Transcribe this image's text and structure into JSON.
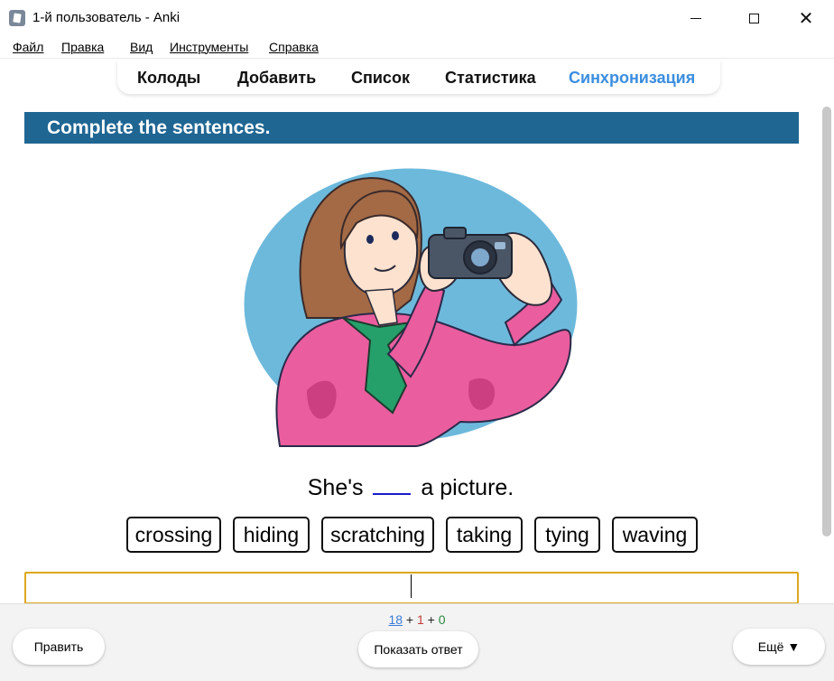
{
  "window": {
    "title": "1-й пользователь - Anki",
    "minimize_glyph": "",
    "close_glyph": "✕"
  },
  "menu": [
    {
      "label": "Файл"
    },
    {
      "label": "Правка"
    },
    {
      "label": "Вид"
    },
    {
      "label": "Инструменты"
    },
    {
      "label": "Справка"
    }
  ],
  "toolbar": {
    "decks": "Колоды",
    "add": "Добавить",
    "browse": "Список",
    "stats": "Статистика",
    "sync": "Синхронизация"
  },
  "card": {
    "header": "Complete the sentences.",
    "sentence_before": "She's",
    "sentence_after": "a picture.",
    "words": [
      "crossing",
      "hiding",
      "scratching",
      "taking",
      "tying",
      "waving"
    ],
    "answer_value": ""
  },
  "bottom": {
    "count_new": "18",
    "count_learn": "1",
    "count_review": "0",
    "plus": "+",
    "edit": "Править",
    "show_answer": "Показать ответ",
    "more": "Ещё ▼"
  },
  "colors": {
    "header_bg": "#1f6693",
    "sync_active": "#3b8ee0",
    "answer_border": "#dca81d",
    "blank_underline": "#1a1acc"
  },
  "icons": {
    "app": "anki-icon",
    "minimize": "minimize-icon",
    "maximize": "maximize-icon",
    "close": "close-icon",
    "picture": "girl-with-camera-illustration"
  }
}
